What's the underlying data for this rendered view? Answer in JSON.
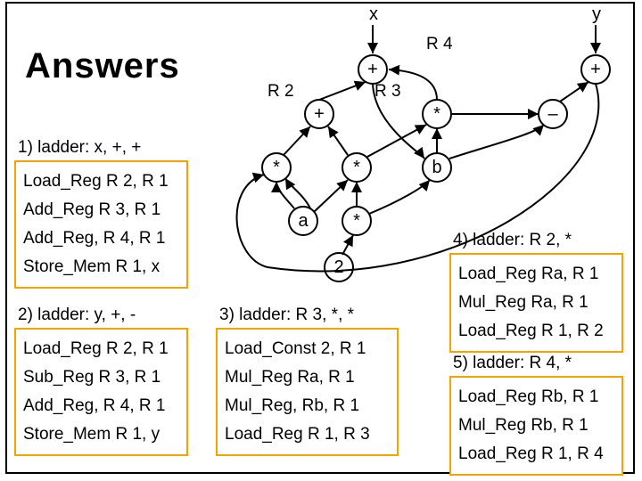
{
  "title": "Answers",
  "inputs": {
    "x": "x",
    "y": "y"
  },
  "reg_labels": {
    "r2": "R 2",
    "r3": "R 3",
    "r4": "R 4"
  },
  "nodes": {
    "plus_x": "+",
    "plus_y": "+",
    "plus_r2": "+",
    "star_r3": "*",
    "minus_y": "–",
    "star_l": "*",
    "star_m": "*",
    "b": "b",
    "a": "a",
    "star_low": "*",
    "two": "2"
  },
  "ladders": {
    "l1": {
      "header": "1) ladder: x, +, +",
      "lines": [
        "Load_Reg R 2, R 1",
        "Add_Reg R 3, R 1",
        "Add_Reg, R 4, R 1",
        "Store_Mem R 1, x"
      ]
    },
    "l2": {
      "header": "2) ladder: y, +, -",
      "lines": [
        "Load_Reg R 2, R 1",
        "Sub_Reg R 3, R 1",
        "Add_Reg, R 4, R 1",
        "Store_Mem R 1, y"
      ]
    },
    "l3": {
      "header": "3) ladder: R 3, *, *",
      "lines": [
        "Load_Const 2, R 1",
        "Mul_Reg Ra, R 1",
        "Mul_Reg, Rb, R 1",
        "Load_Reg R 1, R 3"
      ]
    },
    "l4": {
      "header": "4) ladder: R 2, *",
      "lines": [
        "Load_Reg Ra, R 1",
        "Mul_Reg Ra, R 1",
        "Load_Reg R 1, R 2"
      ]
    },
    "l5": {
      "header": "5) ladder: R 4, *",
      "lines": [
        "Load_Reg Rb, R 1",
        "Mul_Reg Rb, R 1",
        "Load_Reg R 1, R 4"
      ]
    }
  }
}
